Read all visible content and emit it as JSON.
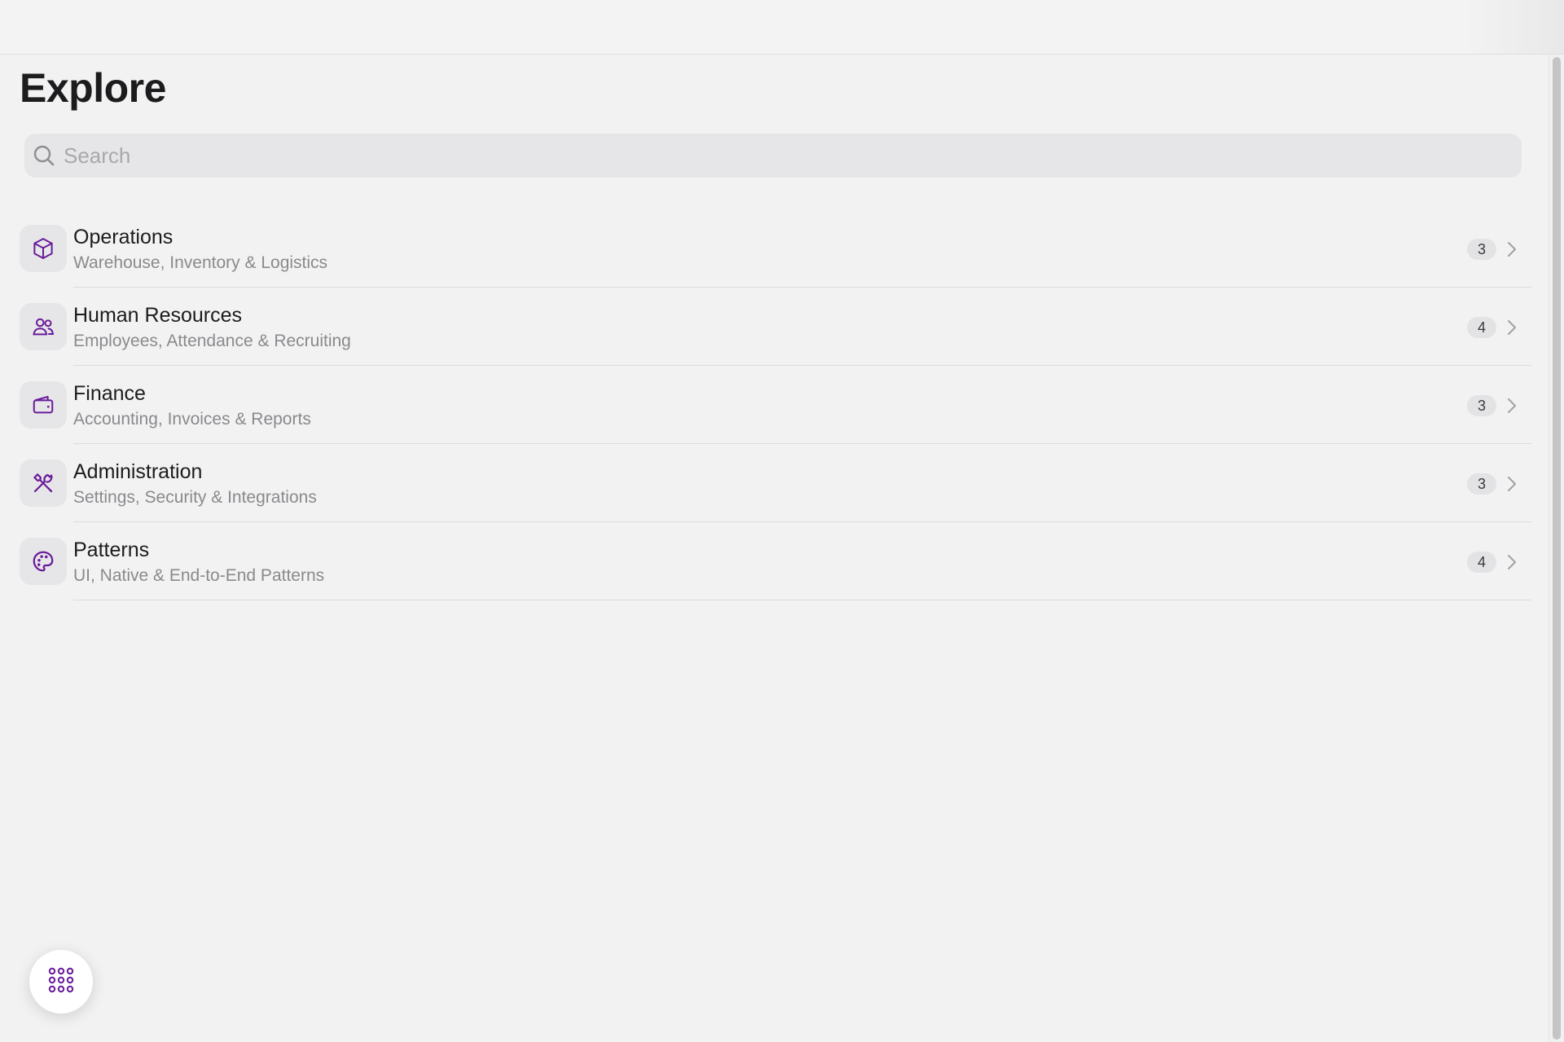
{
  "page": {
    "title": "Explore"
  },
  "search": {
    "placeholder": "Search",
    "value": ""
  },
  "theme": {
    "accent": "#6a1b9a",
    "background": "#f2f2f2"
  },
  "categories": [
    {
      "icon": "box-icon",
      "title": "Operations",
      "subtitle": "Warehouse, Inventory & Logistics",
      "count": "3"
    },
    {
      "icon": "users-icon",
      "title": "Human Resources",
      "subtitle": "Employees, Attendance & Recruiting",
      "count": "4"
    },
    {
      "icon": "wallet-icon",
      "title": "Finance",
      "subtitle": "Accounting, Invoices & Reports",
      "count": "3"
    },
    {
      "icon": "tools-icon",
      "title": "Administration",
      "subtitle": "Settings, Security & Integrations",
      "count": "3"
    },
    {
      "icon": "palette-icon",
      "title": "Patterns",
      "subtitle": "UI, Native & End-to-End Patterns",
      "count": "4"
    }
  ],
  "fab": {
    "icon": "grid-dots-icon"
  }
}
